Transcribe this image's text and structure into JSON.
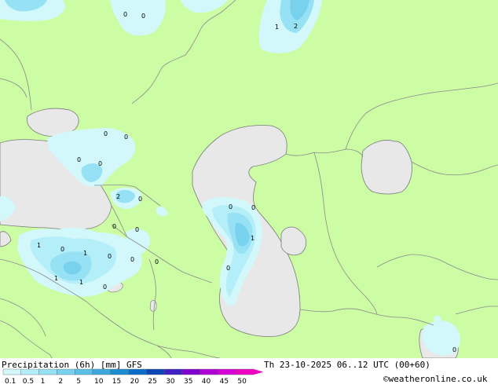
{
  "title": "Precipitation (6h) [mm] GFS",
  "valid_time": "Th 23-10-2025 06..12 UTC (00+60)",
  "credit": "©weatheronline.co.uk",
  "colors": {
    "land": "#ccfca4",
    "water": "#e8e8e8",
    "border": "#9a9a9a",
    "p01": "#d2f8fc",
    "p05": "#b4eef8",
    "p1": "#96e2f4",
    "p2": "#78d2ee",
    "p5": "#5ac0e6"
  },
  "legend": {
    "labels": [
      "0.1",
      "0.5",
      "1",
      "2",
      "5",
      "10",
      "15",
      "20",
      "25",
      "30",
      "35",
      "40",
      "45",
      "50"
    ],
    "colors": [
      "#d2f8fc",
      "#b4eef8",
      "#96e2f4",
      "#78d2ee",
      "#5ac0e6",
      "#3ca8dc",
      "#1e8cd2",
      "#0a6ec8",
      "#0a46b4",
      "#4020c0",
      "#8000d0",
      "#b000d8",
      "#d800d8",
      "#f000c0"
    ]
  },
  "map_labels": [
    "0",
    "0",
    "1",
    "2",
    "0",
    "0",
    "0",
    "0",
    "2",
    "0",
    "0",
    "0",
    "1",
    "0",
    "1",
    "0",
    "0",
    "1",
    "1",
    "0",
    "0",
    "0",
    "1",
    "0",
    "0",
    "0"
  ]
}
